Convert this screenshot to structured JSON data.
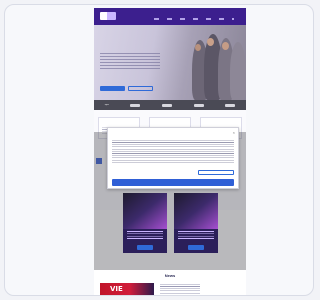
{
  "browser": {
    "page_logo": "logo"
  },
  "navigation": {
    "links": [
      "",
      "",
      "",
      "",
      ""
    ]
  },
  "hero": {
    "title": "",
    "primary_button": "",
    "secondary_button": ""
  },
  "partner_logos": [
    "sync",
    "",
    "",
    "",
    ""
  ],
  "features": [
    {
      "title": ""
    },
    {
      "title": ""
    },
    {
      "title": ""
    }
  ],
  "promos": [
    {
      "button": ""
    },
    {
      "button": ""
    }
  ],
  "news": {
    "title": "News",
    "image_caption": "VIE"
  },
  "cookie_modal": {
    "title": "",
    "close_icon": "close-icon",
    "secondary_button": "",
    "primary_button": ""
  },
  "colors": {
    "nav": "#3c1f8e",
    "accent": "#2f5fd6",
    "promo": "#2b1f5a"
  }
}
